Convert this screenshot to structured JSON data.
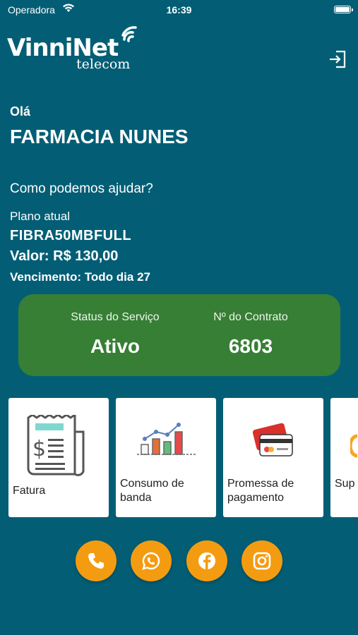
{
  "status_bar": {
    "carrier": "Operadora",
    "time": "16:39"
  },
  "logo": {
    "brand": "VinniNet",
    "sub": "telecom"
  },
  "user": {
    "greeting": "Olá",
    "name": "FARMACIA NUNES",
    "help": "Como podemos ajudar?"
  },
  "plan": {
    "label": "Plano atual",
    "name": "FIBRA50MBFULL",
    "value": "Valor: R$ 130,00",
    "due": "Vencimento: Todo dia 27"
  },
  "status_card": {
    "service_label": "Status do Serviço",
    "service_value": "Ativo",
    "contract_label": "Nº do Contrato",
    "contract_value": "6803",
    "color": "#367f35"
  },
  "tiles": [
    {
      "label": "Fatura",
      "icon": "invoice-icon"
    },
    {
      "label": "Consumo de banda",
      "icon": "bandwidth-chart-icon"
    },
    {
      "label": "Promessa de pagamento",
      "icon": "credit-card-icon"
    },
    {
      "label": "Sup",
      "icon": "support-icon"
    }
  ],
  "socials": [
    {
      "icon": "phone-icon"
    },
    {
      "icon": "whatsapp-icon"
    },
    {
      "icon": "facebook-icon"
    },
    {
      "icon": "instagram-icon"
    }
  ],
  "colors": {
    "background": "#035e75",
    "accent": "#f39c12",
    "status_card": "#367f35"
  }
}
